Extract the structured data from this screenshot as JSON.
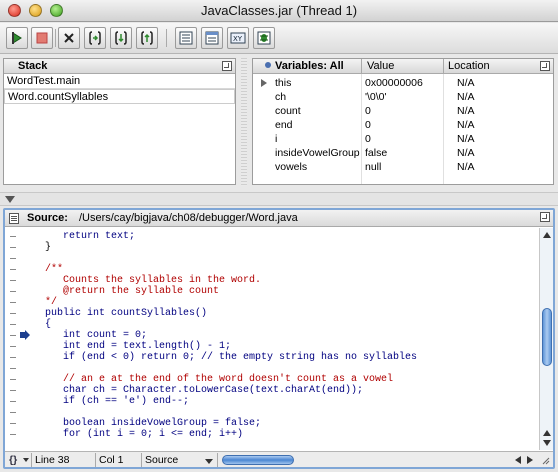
{
  "window": {
    "title": "JavaClasses.jar (Thread 1)"
  },
  "toolbar": {
    "buttons": [
      {
        "name": "run-icon"
      },
      {
        "name": "stop-icon"
      },
      {
        "name": "kill-icon"
      },
      {
        "name": "step-over-icon"
      },
      {
        "name": "step-into-icon"
      },
      {
        "name": "step-out-icon"
      },
      {
        "name": "list-view-icon"
      },
      {
        "name": "detail-view-icon"
      },
      {
        "name": "xy-view-icon"
      },
      {
        "name": "bug-icon"
      }
    ]
  },
  "stack": {
    "title": "Stack",
    "frames": [
      "WordTest.main",
      "Word.countSyllables"
    ]
  },
  "variables": {
    "headers": {
      "name": "Variables: All",
      "value": "Value",
      "location": "Location"
    },
    "rows": [
      {
        "name": "this",
        "value": "0x00000006",
        "location": "N/A"
      },
      {
        "name": "ch",
        "value": "'\\0\\0'",
        "location": "N/A"
      },
      {
        "name": "count",
        "value": "0",
        "location": "N/A"
      },
      {
        "name": "end",
        "value": "0",
        "location": "N/A"
      },
      {
        "name": "i",
        "value": "0",
        "location": "N/A"
      },
      {
        "name": "insideVowelGroup",
        "value": "false",
        "location": "N/A"
      },
      {
        "name": "vowels",
        "value": "null",
        "location": "N/A"
      }
    ]
  },
  "source": {
    "label": "Source:",
    "path": "/Users/cay/bigjava/ch08/debugger/Word.java",
    "lines": [
      {
        "text": "   return text;",
        "kind": "kw"
      },
      {
        "text": "}",
        "kind": "pl"
      },
      {
        "text": "",
        "kind": "pl"
      },
      {
        "text": "/**",
        "kind": "cm"
      },
      {
        "text": "   Counts the syllables in the word.",
        "kind": "cm"
      },
      {
        "text": "   @return the syllable count",
        "kind": "cm"
      },
      {
        "text": "*/",
        "kind": "cm"
      },
      {
        "text": "public int countSyllables()",
        "kind": "kw"
      },
      {
        "text": "{",
        "kind": "kw"
      },
      {
        "text": "   int count = 0;",
        "kind": "kw"
      },
      {
        "text": "   int end = text.length() - 1;",
        "kind": "kw"
      },
      {
        "text": "   if (end < 0) return 0; // the empty string has no syllables",
        "kind": "kw"
      },
      {
        "text": "",
        "kind": "pl"
      },
      {
        "text": "   // an e at the end of the word doesn't count as a vowel",
        "kind": "cm"
      },
      {
        "text": "   char ch = Character.toLowerCase(text.charAt(end));",
        "kind": "kw"
      },
      {
        "text": "   if (ch == 'e') end--;",
        "kind": "kw"
      },
      {
        "text": "",
        "kind": "pl"
      },
      {
        "text": "   boolean insideVowelGroup = false;",
        "kind": "kw"
      },
      {
        "text": "   for (int i = 0; i <= end; i++)",
        "kind": "kw"
      }
    ]
  },
  "status": {
    "line": "Line 38",
    "col": "Col 1",
    "mode": "Source"
  },
  "colors": {
    "accent": "#7fa6d6",
    "keyword": "#000080",
    "comment": "#b00000"
  }
}
